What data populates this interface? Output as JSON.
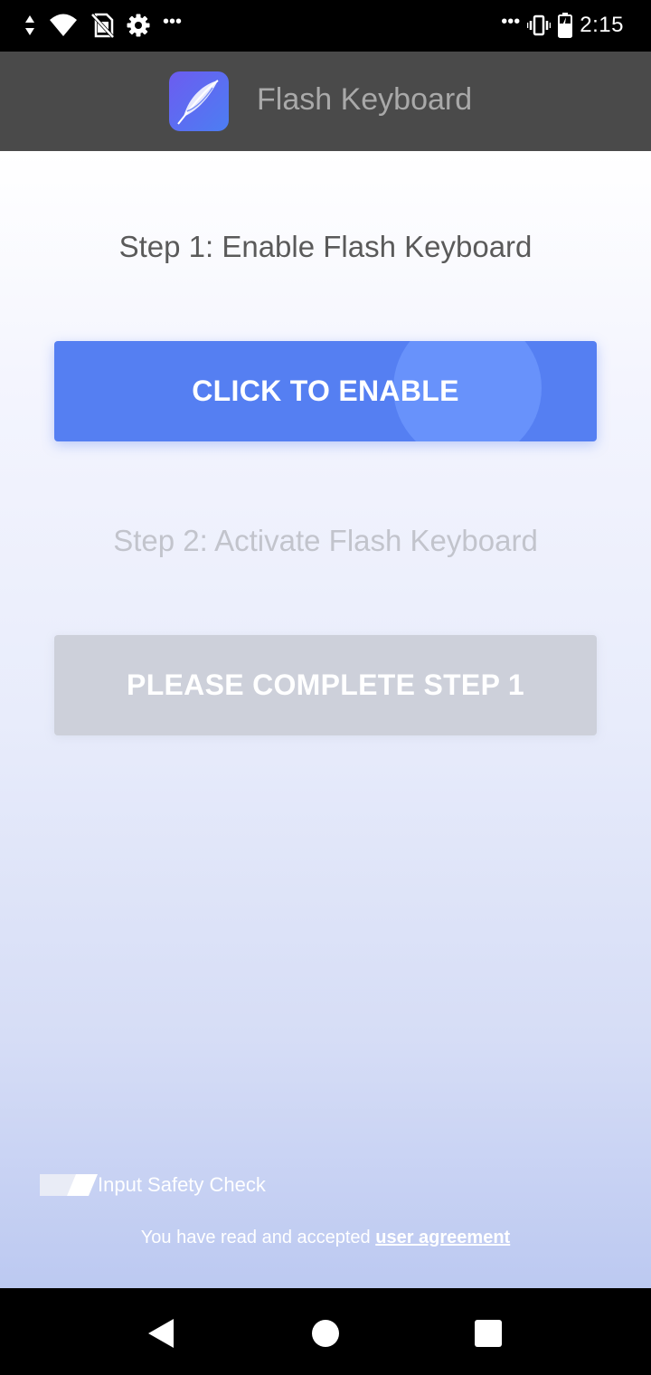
{
  "status_bar": {
    "time": "2:15",
    "left_icons": [
      "data-arrows-icon",
      "wifi-icon",
      "no-sim-icon",
      "settings-gear-icon",
      "more-dots-icon"
    ],
    "right_icons": [
      "more-dots-icon",
      "vibrate-icon",
      "battery-icon"
    ],
    "left_dots": "•••",
    "right_dots": "•••"
  },
  "app_bar": {
    "title": "Flash Keyboard",
    "icon": "feather-app-icon"
  },
  "steps": {
    "step1_title": "Step 1: Enable Flash Keyboard",
    "step1_button": "CLICK TO ENABLE",
    "step2_title": "Step 2: Activate Flash Keyboard",
    "step2_button": "PLEASE COMPLETE STEP 1"
  },
  "footer": {
    "safety_label": "Input Safety Check",
    "agreement_prefix": "You have read and accepted ",
    "agreement_link": "user agreement"
  },
  "colors": {
    "status_bar": "#000000",
    "app_bar": "#4a4a4a",
    "primary_button": "#557ff2",
    "disabled_button": "#cdd0da",
    "app_title": "#a9a9a9"
  },
  "nav_bar": {
    "buttons": [
      "back-icon",
      "home-icon",
      "recent-apps-icon"
    ]
  }
}
